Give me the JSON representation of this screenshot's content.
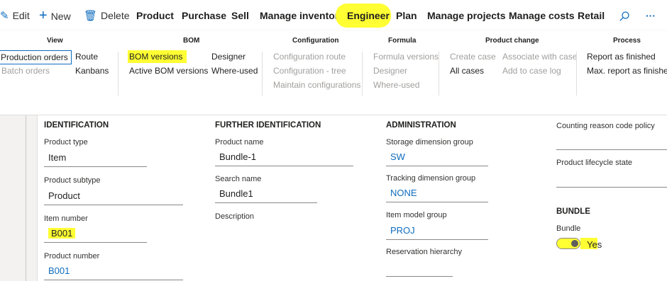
{
  "actionPane": {
    "edit": "Edit",
    "new": "New",
    "delete": "Delete",
    "tabs": [
      "Product",
      "Purchase",
      "Sell",
      "Manage inventory",
      "Engineer",
      "Plan",
      "Manage projects",
      "Manage costs",
      "Retail"
    ],
    "active_tab": "Engineer",
    "more": "···"
  },
  "ribbon": {
    "view": {
      "title": "View",
      "production_orders": "Production orders",
      "batch_orders": "Batch orders",
      "route": "Route",
      "kanbans": "Kanbans"
    },
    "bom": {
      "title": "BOM",
      "bom_versions": "BOM versions",
      "active_bom_versions": "Active BOM versions",
      "designer": "Designer",
      "where_used": "Where-used"
    },
    "configuration": {
      "title": "Configuration",
      "configuration_route": "Configuration route",
      "configuration_tree": "Configuration - tree",
      "maintain_configurations": "Maintain configurations"
    },
    "formula": {
      "title": "Formula",
      "formula_versions": "Formula versions",
      "designer": "Designer",
      "where_used": "Where-used"
    },
    "product_change": {
      "title": "Product change",
      "create_case": "Create case",
      "associate_with_case": "Associate with case",
      "all_cases": "All cases",
      "add_to_case_log": "Add to case log"
    },
    "process": {
      "title": "Process",
      "report_as_finished": "Report as finished",
      "max_report_as_finished": "Max. report as finished"
    }
  },
  "identification": {
    "header": "IDENTIFICATION",
    "product_type_label": "Product type",
    "product_type": "Item",
    "product_subtype_label": "Product subtype",
    "product_subtype": "Product",
    "item_number_label": "Item number",
    "item_number": "B001",
    "product_number_label": "Product number",
    "product_number": "B001"
  },
  "further_identification": {
    "header": "FURTHER IDENTIFICATION",
    "product_name_label": "Product name",
    "product_name": "Bundle-1",
    "search_name_label": "Search name",
    "search_name": "Bundle1",
    "description_label": "Description"
  },
  "administration": {
    "header": "ADMINISTRATION",
    "storage_label": "Storage dimension group",
    "storage": "SW",
    "tracking_label": "Tracking dimension group",
    "tracking": "NONE",
    "item_model_label": "Item model group",
    "item_model": "PROJ",
    "reservation_label": "Reservation hierarchy"
  },
  "other": {
    "counting_reason_label": "Counting reason code policy",
    "lifecycle_label": "Product lifecycle state"
  },
  "bundle": {
    "header": "BUNDLE",
    "bundle_label": "Bundle",
    "bundle_value": "Yes"
  },
  "colors": {
    "accent": "#0f6cbd",
    "highlight": "#ffff33"
  }
}
